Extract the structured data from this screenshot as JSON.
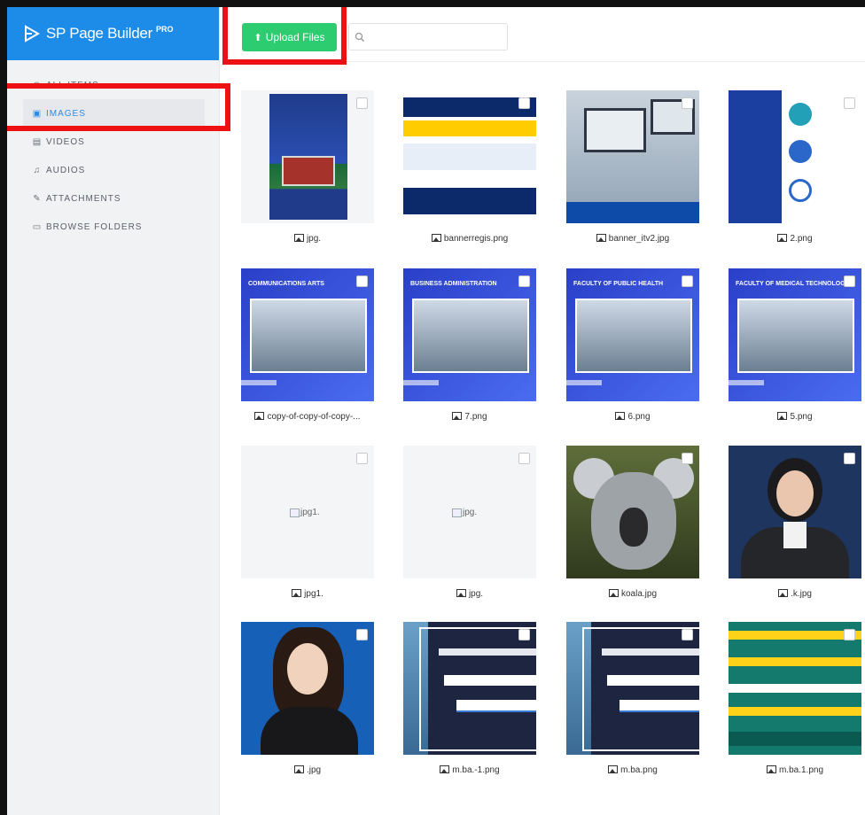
{
  "brand": {
    "name": "SP Page Builder",
    "badge": "PRO"
  },
  "sidebar": {
    "items": [
      {
        "label": "ALL ITEMS",
        "icon": "all-items-icon",
        "glyph": "⊘",
        "active": false
      },
      {
        "label": "IMAGES",
        "icon": "image-icon",
        "glyph": "▣",
        "active": true
      },
      {
        "label": "VIDEOS",
        "icon": "film-icon",
        "glyph": "▤",
        "active": false
      },
      {
        "label": "AUDIOS",
        "icon": "music-icon",
        "glyph": "♫",
        "active": false
      },
      {
        "label": "ATTACHMENTS",
        "icon": "paperclip-icon",
        "glyph": "✎",
        "active": false
      },
      {
        "label": "BROWSE FOLDERS",
        "icon": "folder-icon",
        "glyph": "▭",
        "active": false
      }
    ]
  },
  "toolbar": {
    "upload_label": "Upload Files",
    "search_value": "",
    "search_placeholder": ""
  },
  "media": [
    {
      "name": "jpg.",
      "kind": "brochure"
    },
    {
      "name": "bannerregis.png",
      "kind": "bannerregis"
    },
    {
      "name": "banner_itv2.jpg",
      "kind": "computers"
    },
    {
      "name": "2.png",
      "kind": "info"
    },
    {
      "name": "copy-of-copy-of-copy-...",
      "kind": "faculty",
      "title": "COMMUNICATIONS ARTS"
    },
    {
      "name": "7.png",
      "kind": "faculty",
      "title": "BUSINESS ADMINISTRATION"
    },
    {
      "name": "6.png",
      "kind": "faculty",
      "title": "FACULTY OF PUBLIC HEALTH"
    },
    {
      "name": "5.png",
      "kind": "faculty",
      "title": "FACULTY OF MEDICAL TECHNOLOGY"
    },
    {
      "name": "jpg1.",
      "kind": "broken",
      "alt": "jpg1."
    },
    {
      "name": "jpg.",
      "kind": "broken",
      "alt": "jpg."
    },
    {
      "name": "koala.jpg",
      "kind": "koala"
    },
    {
      "name": ".k.jpg",
      "kind": "portrait-dark"
    },
    {
      "name": ".jpg",
      "kind": "portrait-blue"
    },
    {
      "name": "m.ba.-1.png",
      "kind": "mba"
    },
    {
      "name": "m.ba.png",
      "kind": "mba"
    },
    {
      "name": "m.ba.1.png",
      "kind": "mba-green"
    }
  ],
  "colors": {
    "brand_blue": "#1d8ce8",
    "upload_green": "#2ecc71",
    "highlight_red": "#ee1111"
  }
}
